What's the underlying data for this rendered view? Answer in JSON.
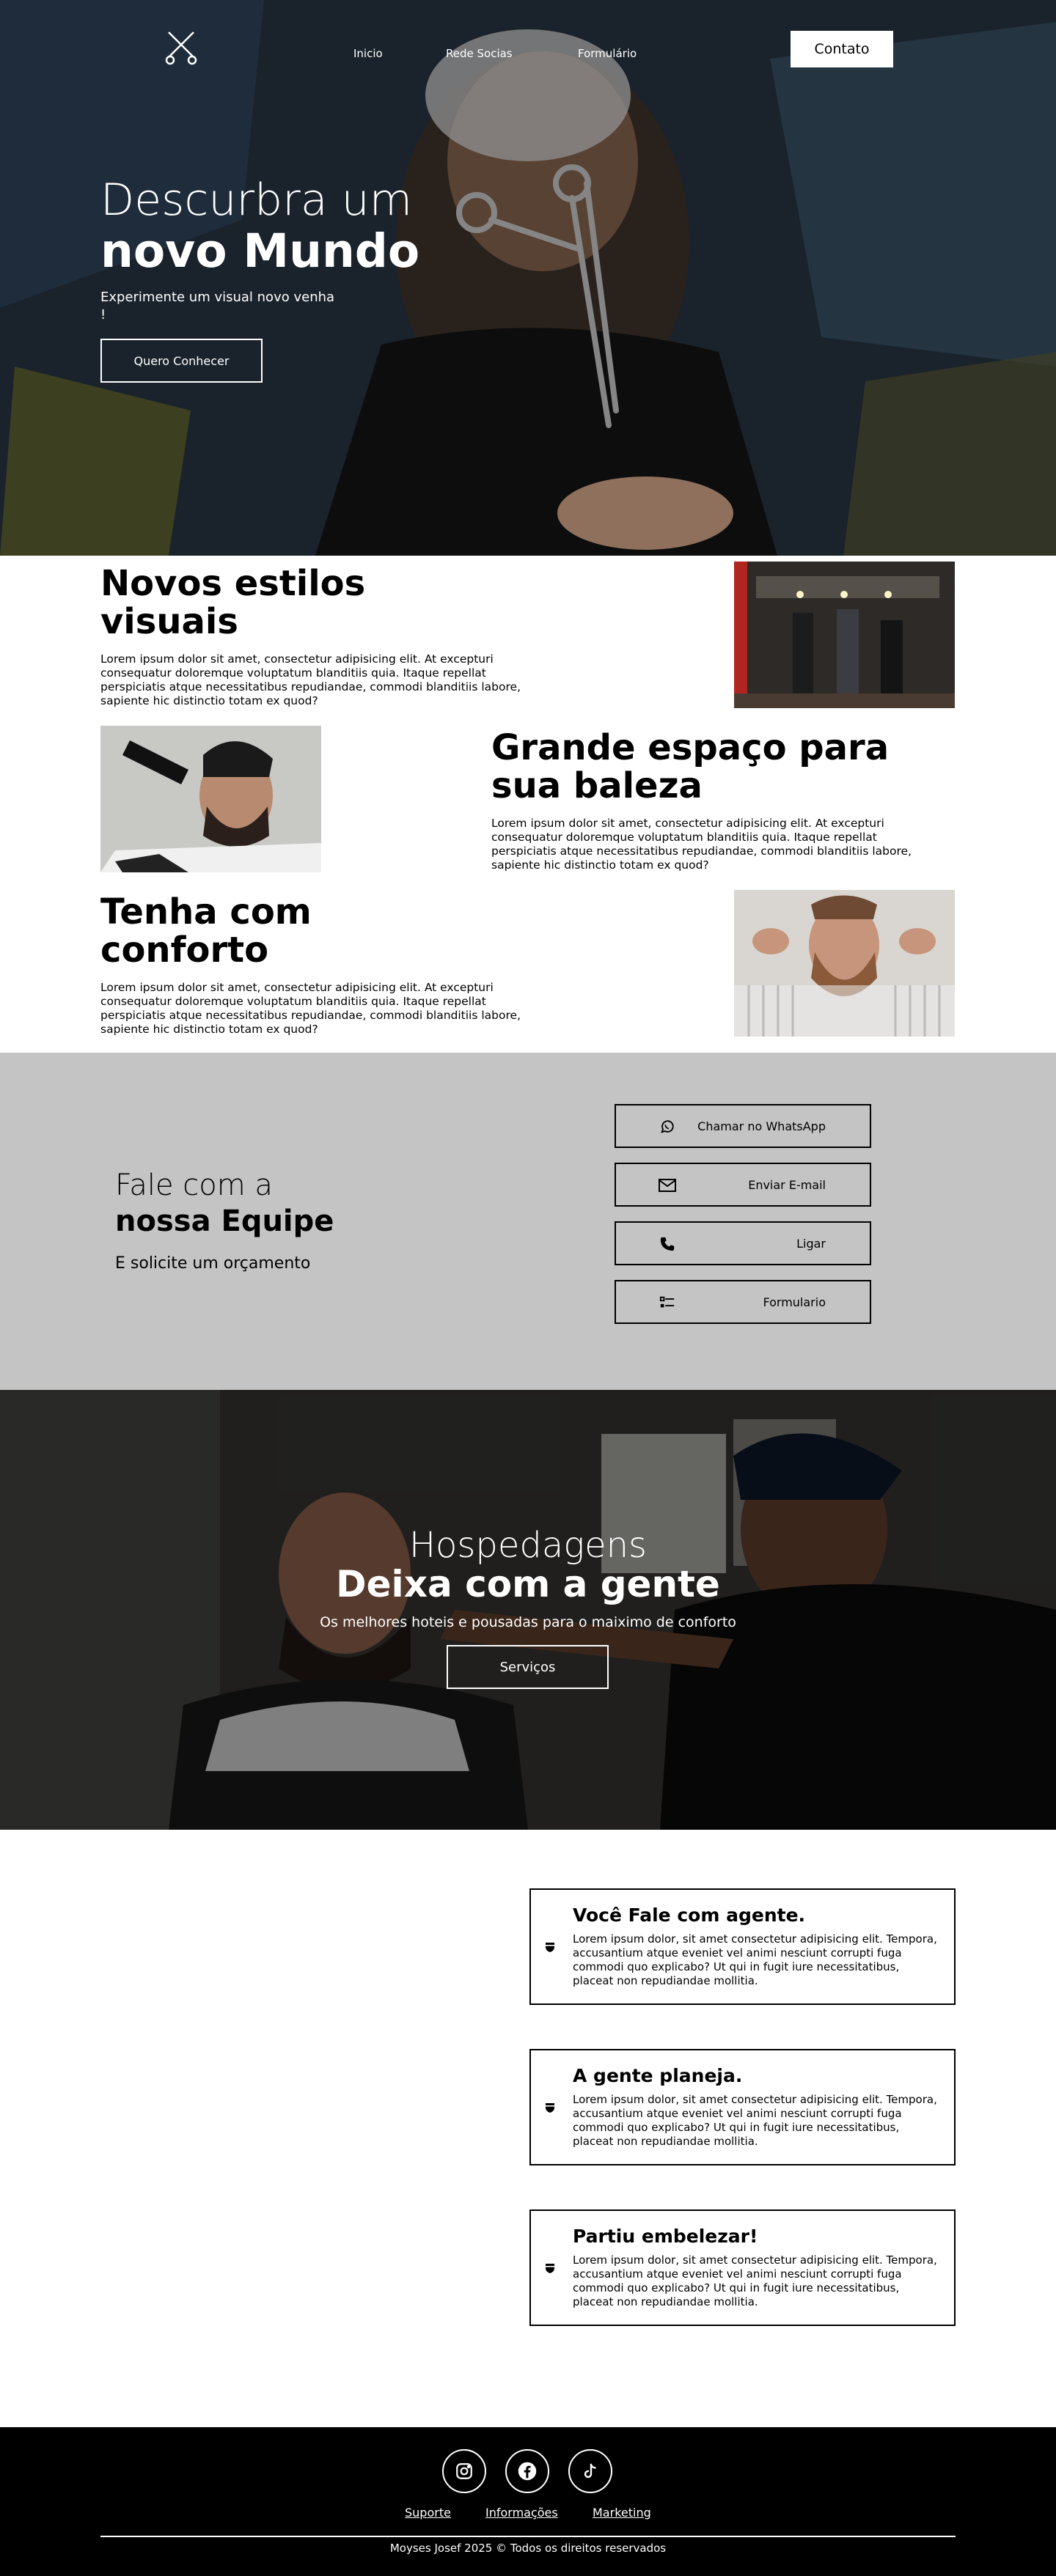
{
  "header": {
    "nav": [
      "Inicio",
      "Rede Socias",
      "Formulário"
    ],
    "contact_button": "Contato",
    "logo_icon": "scissors-icon"
  },
  "hero": {
    "title_line1": "Descurbra um",
    "title_line2": "novo Mundo",
    "subtitle": "Experimente um visual novo venha !",
    "button": "Quero Conhecer"
  },
  "features": [
    {
      "title": "Novos estilos visuais",
      "text": "Lorem ipsum dolor sit amet, consectetur adipisicing elit. At excepturi consequatur doloremque voluptatum blanditiis quia. Itaque repellat perspiciatis atque necessitatibus repudiandae, commodi blanditiis labore, sapiente hic distinctio totam ex quod?"
    },
    {
      "title": "Grande espaço para sua baleza",
      "text": "Lorem ipsum dolor sit amet, consectetur adipisicing elit. At excepturi consequatur doloremque voluptatum blanditiis quia. Itaque repellat perspiciatis atque necessitatibus repudiandae, commodi blanditiis labore, sapiente hic distinctio totam ex quod?"
    },
    {
      "title": "Tenha com conforto",
      "text": "Lorem ipsum dolor sit amet, consectetur adipisicing elit. At excepturi consequatur doloremque voluptatum blanditiis quia. Itaque repellat perspiciatis atque necessitatibus repudiandae, commodi blanditiis labore, sapiente hic distinctio totam ex quod?"
    }
  ],
  "contact": {
    "title_line1": "Fale com a",
    "title_line2": "nossa Equipe",
    "subtitle": "E solicite um orçamento",
    "buttons": [
      {
        "label": "Chamar no WhatsApp",
        "icon": "whatsapp-icon"
      },
      {
        "label": "Enviar E-mail",
        "icon": "email-icon"
      },
      {
        "label": "Ligar",
        "icon": "phone-icon"
      },
      {
        "label": "Formulario",
        "icon": "form-list-icon"
      }
    ]
  },
  "lodging": {
    "title_line1": "Hospedagens",
    "title_line2": "Deixa com a gente",
    "subtitle": "Os melhores hoteis e pousadas para o maiximo de conforto",
    "button": "Serviços"
  },
  "steps": [
    {
      "title": "Você Fale com agente.",
      "text": "Lorem ipsum dolor, sit amet consectetur adipisicing elit. Tempora, accusantium atque eveniet vel animi nesciunt corrupti fuga commodi quo explicabo? Ut qui in fugit iure necessitatibus, placeat non repudiandae mollitia."
    },
    {
      "title": "A gente planeja.",
      "text": "Lorem ipsum dolor, sit amet consectetur adipisicing elit. Tempora, accusantium atque eveniet vel animi nesciunt corrupti fuga commodi quo explicabo? Ut qui in fugit iure necessitatibus, placeat non repudiandae mollitia."
    },
    {
      "title": "Partiu embelezar!",
      "text": "Lorem ipsum dolor, sit amet consectetur adipisicing elit. Tempora, accusantium atque eveniet vel animi nesciunt corrupti fuga commodi quo explicabo? Ut qui in fugit iure necessitatibus, placeat non repudiandae mollitia."
    }
  ],
  "footer": {
    "social": [
      "instagram-icon",
      "facebook-icon",
      "tiktok-icon"
    ],
    "links": [
      "Suporte",
      "Informações",
      "Marketing"
    ],
    "copyright": "Moyses Josef 2025 © Todos os direitos reservados"
  },
  "colors": {
    "contact_bg": "#c4c4c4",
    "footer_bg": "#000000",
    "text": "#000000",
    "light_text": "#ffffff"
  }
}
